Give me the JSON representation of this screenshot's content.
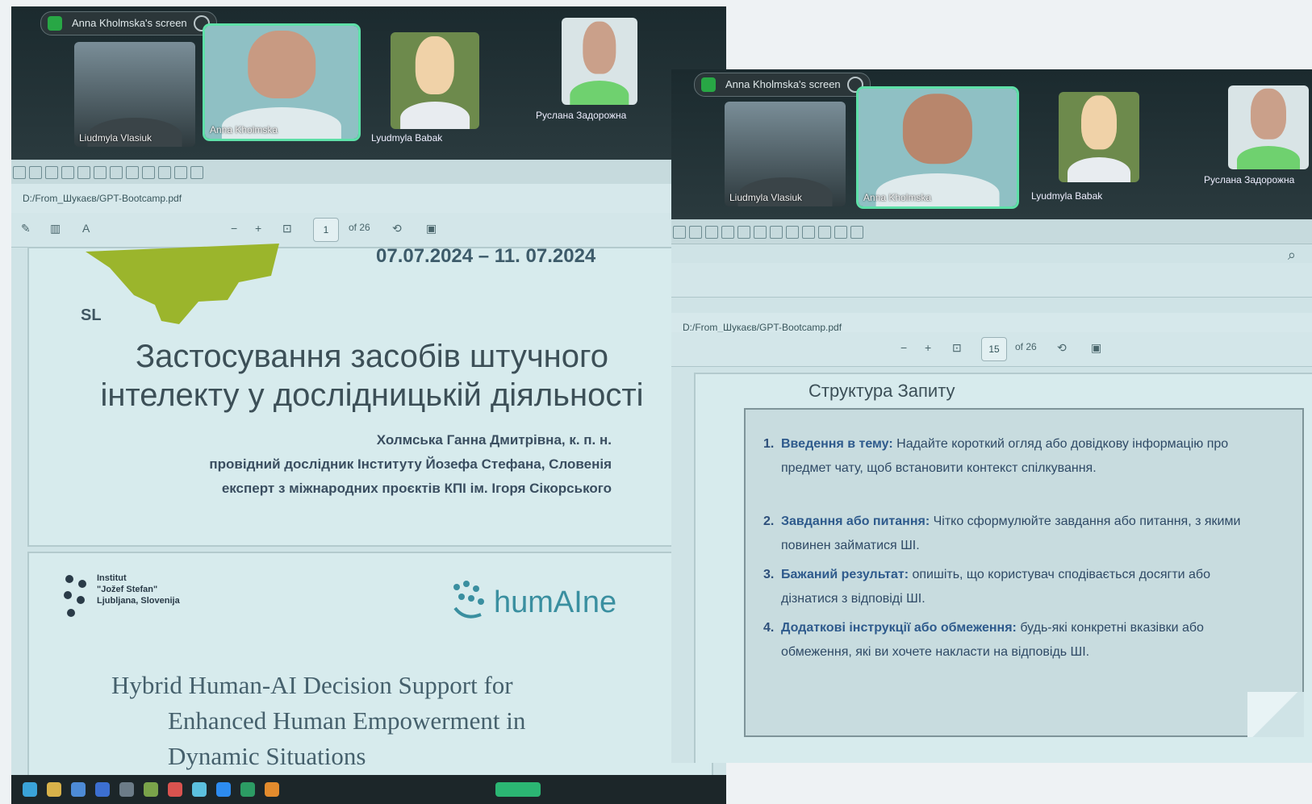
{
  "screens": {
    "share_label": "Anna Kholmska's screen",
    "participants": {
      "p1": "Liudmyla Vlasiuk",
      "p2": "Anna Kholmska",
      "p3": "Lyudmyla Babak",
      "p4": "Руслана Задорожна"
    },
    "file_path": "D:/From_Шукаєв/GPT-Bootcamp.pdf",
    "page_total": "of 26"
  },
  "left_slide": {
    "page_number": "1",
    "dates": "07.07.2024 – 11. 07.2024",
    "logo_text": "SL",
    "title_line1": "Застосування засобів штучного",
    "title_line2": "інтелекту у дослідницькій діяльності",
    "author_name": "Холмська Ганна Дмитрівна, к. п. н.",
    "author_role1": "провідний дослідник Інституту Йозефа Стефана, Словенія",
    "author_role2": "експерт з міжнародних проєктів КПІ ім. Ігоря Сікорського",
    "inst_line1": "Institut",
    "inst_line2": "\"Jožef Stefan\"",
    "inst_line3": "Ljubljana, Slovenija",
    "humaine_logo": "humAIne",
    "eng_title_line1": "Hybrid Human-AI Decision Support for",
    "eng_title_line2": "Enhanced Human Empowerment in",
    "eng_title_line3": "Dynamic Situations"
  },
  "right_slide": {
    "page_number": "15",
    "heading": "Структура Запиту",
    "items": [
      {
        "num": "1.",
        "lead": "Введення в тему:",
        "text": "Надайте короткий огляд або довідкову інформацію про предмет чату, щоб встановити контекст спілкування."
      },
      {
        "num": "2.",
        "lead": "Завдання або питання:",
        "text": "Чітко сформулюйте завдання або питання, з якими повинен займатися ШІ."
      },
      {
        "num": "3.",
        "lead": "Бажаний результат:",
        "text": "опишіть, що користувач сподівається досягти або дізнатися з відповіді ШІ."
      },
      {
        "num": "4.",
        "lead": "Додаткові інструкції або обмеження:",
        "text": "будь-які конкретні вказівки або обмеження, які ви хочете накласти на відповідь ШІ."
      }
    ]
  },
  "colors": {
    "slide_bg": "#d7ebed",
    "title_text": "#3c4f57",
    "accent_green": "#9bb52c",
    "zoom_active": "#5ee0a8"
  }
}
